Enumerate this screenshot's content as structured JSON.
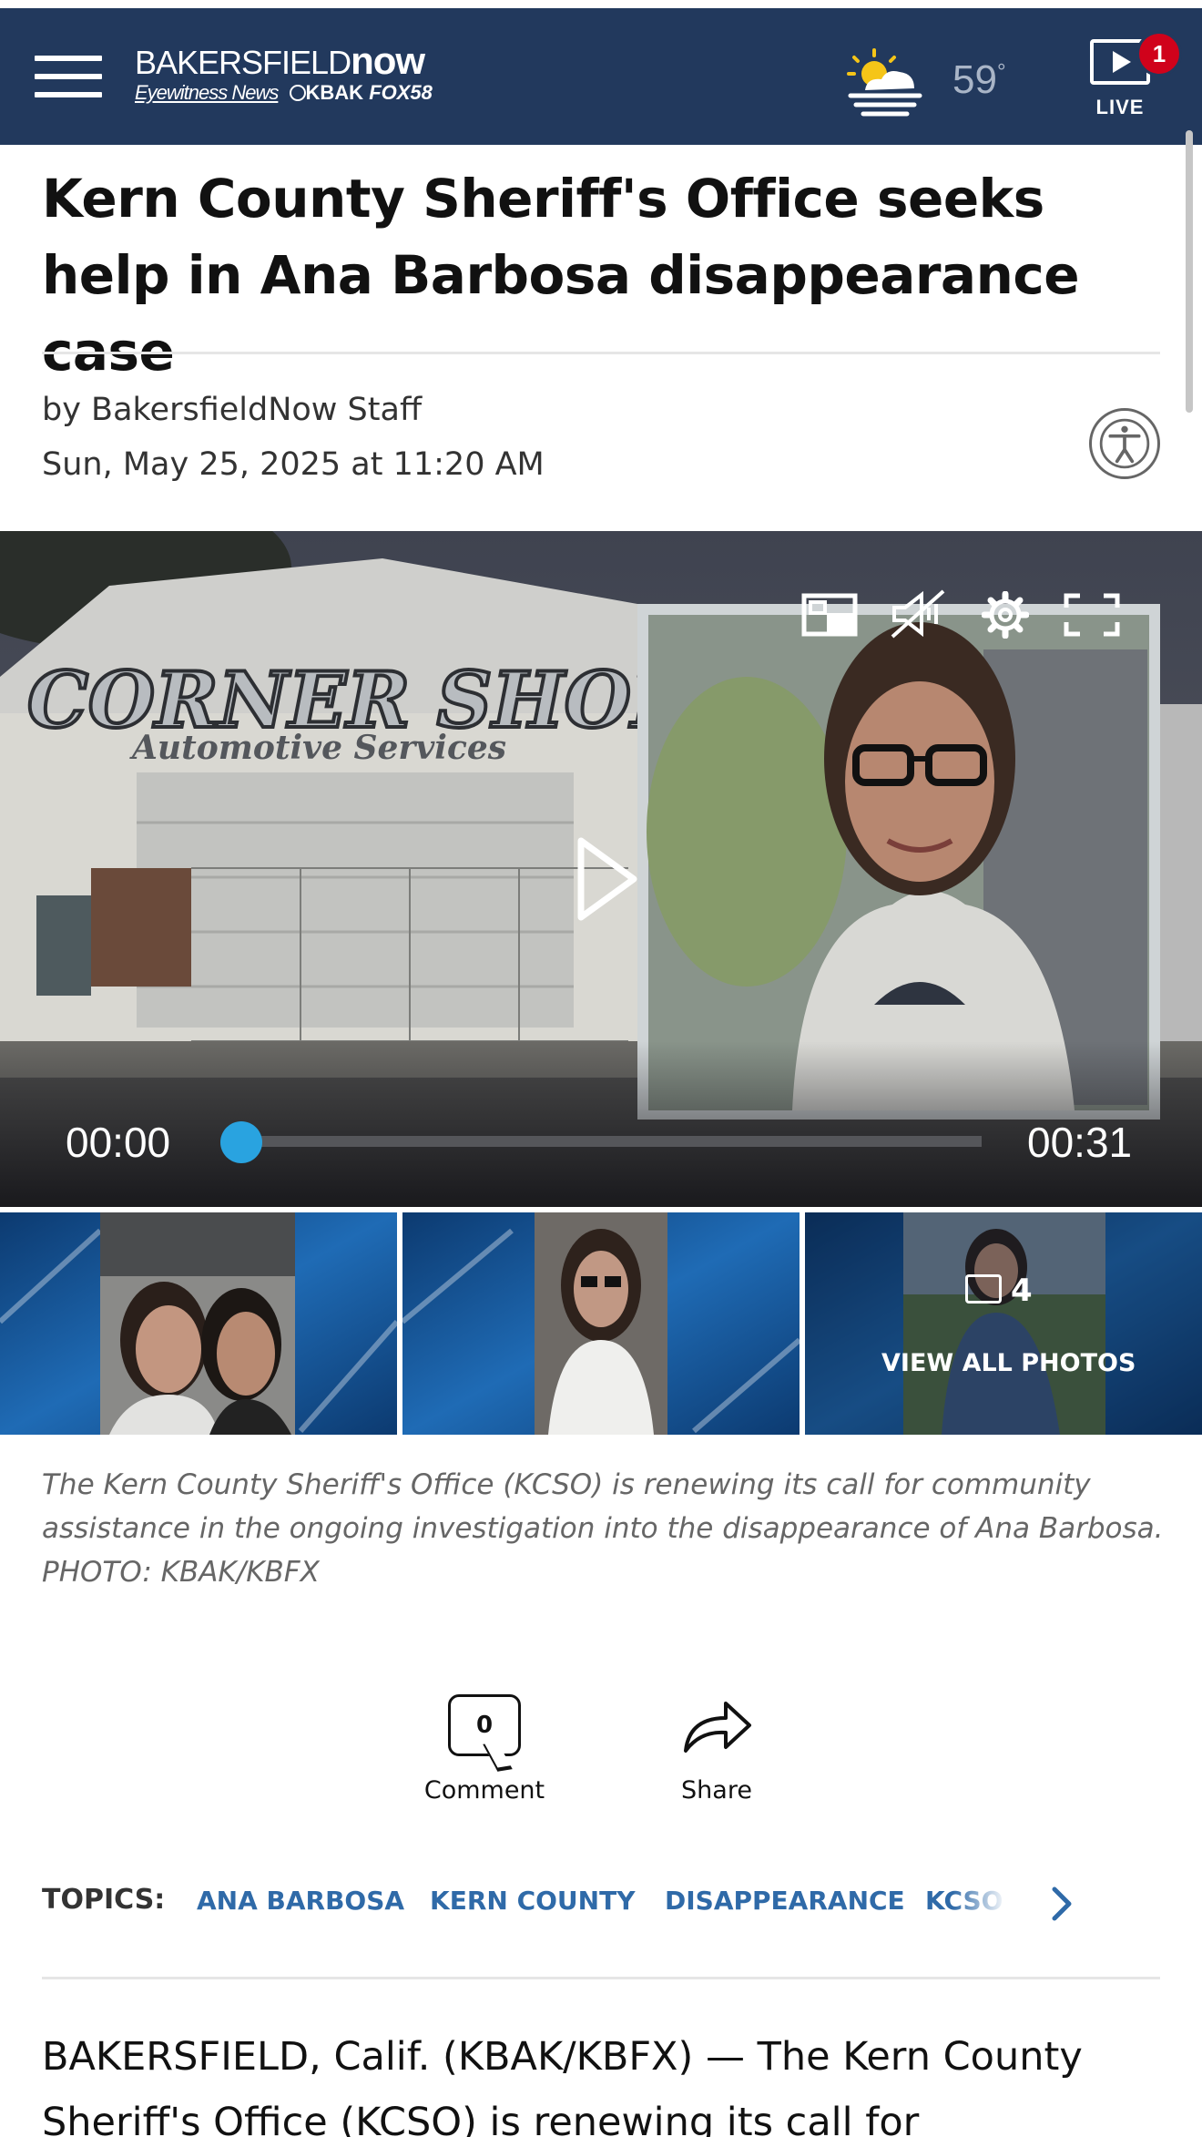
{
  "header": {
    "logo_top_light": "BAKERSFIELD",
    "logo_top_bold": "now",
    "logo_eyewitness": "Eyewitness News",
    "logo_kbak": "KBAK",
    "logo_fox": "FOX58",
    "temperature": "59",
    "temperature_unit": "°",
    "live_label": "LIVE",
    "live_badge_count": "1"
  },
  "article": {
    "title": "Kern County Sheriff's Office seeks help in Ana Barbosa disappearance case",
    "byline": "by BakersfieldNow Staff",
    "date": "Sun, May 25, 2025 at 11:20 AM"
  },
  "video": {
    "sign_line1": "CORNER SHOP",
    "sign_line2": "Automotive Services",
    "time_current": "00:00",
    "time_total": "00:31",
    "progress": 0.0
  },
  "gallery": {
    "count": "4",
    "view_all_label": "VIEW ALL PHOTOS",
    "caption": "The Kern County Sheriff's Office (KCSO) is renewing its call for community assistance in the ongoing investigation into the disappearance of Ana Barbosa. PHOTO: KBAK/KBFX"
  },
  "actions": {
    "comment_count": "0",
    "comment_label": "Comment",
    "share_label": "Share"
  },
  "topics": {
    "label": "TOPICS:",
    "items": [
      "ANA BARBOSA",
      "KERN COUNTY",
      "DISAPPEARANCE",
      "KCSO"
    ]
  },
  "body": {
    "paragraph1": "BAKERSFIELD, Calif. (KBAK/KBFX) — The Kern County Sheriff's Office (KCSO) is renewing its call for"
  },
  "colors": {
    "header_bg": "#22395d",
    "topic_link": "#2f6aa8",
    "badge_red": "#d0021b",
    "progress_accent": "#29a3e0"
  }
}
